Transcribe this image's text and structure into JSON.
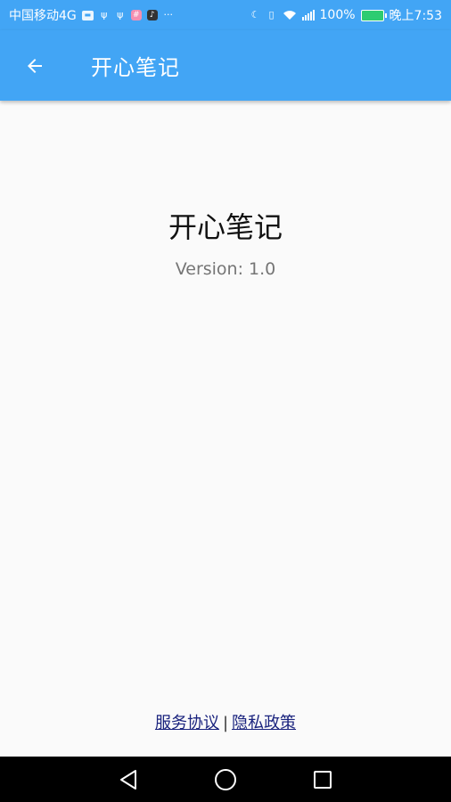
{
  "status_bar": {
    "carrier": "中国移动4G",
    "battery": "100%",
    "time": "晚上7:53",
    "icons": [
      "briefcase-icon",
      "usb-icon",
      "usb-icon",
      "app-badge-icon",
      "tiktok-icon",
      "more-icon",
      "moon-icon",
      "vibrate-icon",
      "wifi-icon",
      "signal-icon",
      "battery-icon"
    ]
  },
  "app_bar": {
    "title": "开心笔记",
    "back_icon": "arrow-left-icon"
  },
  "about": {
    "app_name": "开心笔记",
    "version": "Version: 1.0"
  },
  "footer": {
    "service_link": "服务协议",
    "separator": "|",
    "privacy_link": "隐私政策"
  },
  "nav_bar": {
    "icons": [
      "back-triangle-icon",
      "home-circle-icon",
      "recents-square-icon"
    ]
  },
  "colors": {
    "primary": "#42a5f5",
    "background": "#fafafa",
    "link": "#1a237e"
  }
}
